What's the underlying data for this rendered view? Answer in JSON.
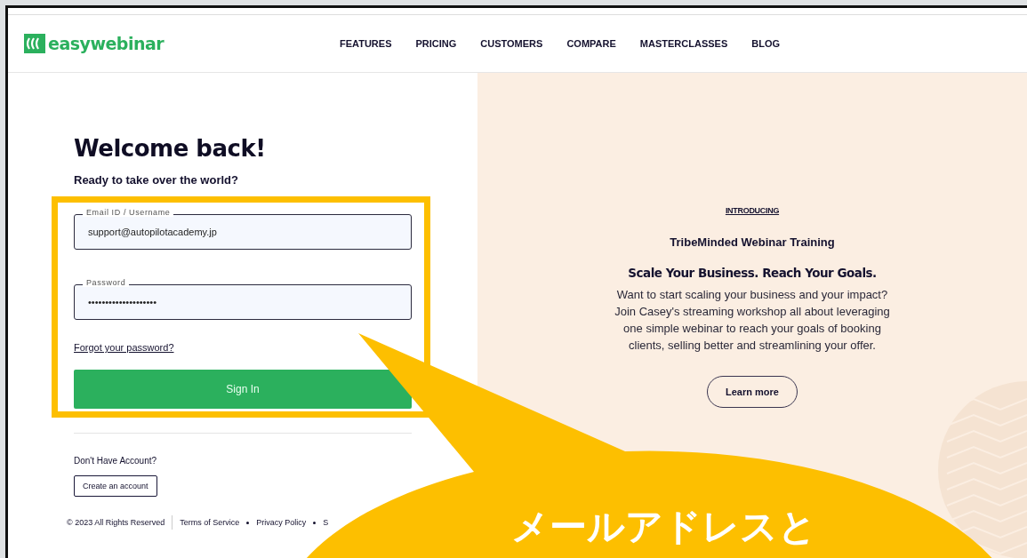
{
  "header": {
    "logo": "easywebinar",
    "nav": [
      {
        "label": "FEATURES"
      },
      {
        "label": "PRICING"
      },
      {
        "label": "CUSTOMERS"
      },
      {
        "label": "COMPARE"
      },
      {
        "label": "MASTERCLASSES"
      },
      {
        "label": "BLOG"
      }
    ]
  },
  "login": {
    "title": "Welcome back!",
    "subtitle": "Ready to take over the world?",
    "email": {
      "label": "Email ID / Username",
      "value": "support@autopilotacademy.jp"
    },
    "password": {
      "label": "Password",
      "value": "••••••••••••••••••••"
    },
    "forgot": "Forgot your password?",
    "submit": "Sign In",
    "no_account": "Don't Have Account?",
    "create": "Create an account"
  },
  "footer": {
    "copyright": "© 2023 All Rights Reserved",
    "links": [
      "Terms of Service",
      "Privacy Policy",
      "S"
    ]
  },
  "promo": {
    "eyebrow": "INTRODUCING",
    "name": "TribeMinded Webinar Training",
    "headline": "Scale Your Business. Reach Your Goals.",
    "body": "Want to start scaling your business and your impact? Join Casey's streaming workshop all about leveraging one simple webinar to reach your goals of booking clients, selling better and streamlining your offer.",
    "button": "Learn more"
  },
  "annotation": {
    "callout": "メールアドレスと"
  }
}
